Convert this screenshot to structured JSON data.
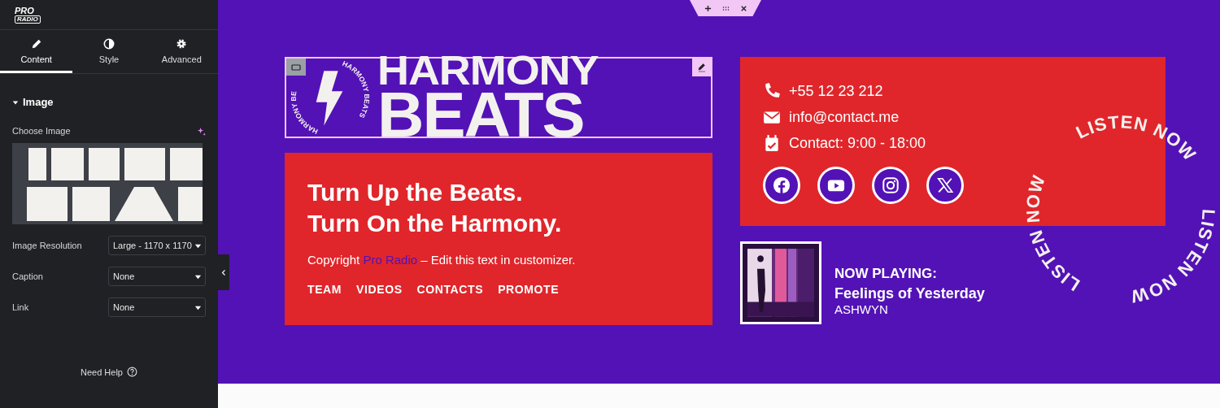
{
  "sidebar": {
    "brand": {
      "line_1": "PRO",
      "line_2": "RADIO"
    },
    "tabs": [
      {
        "label": "Content",
        "selected": true
      },
      {
        "label": "Style",
        "selected": false
      },
      {
        "label": "Advanced",
        "selected": false
      }
    ],
    "section": {
      "title": "Image",
      "expanded": true
    },
    "choose_image": {
      "label": "Choose Image"
    },
    "fields": [
      {
        "label": "Image Resolution",
        "value": "Large - 1170 x 1170"
      },
      {
        "label": "Caption",
        "value": "None"
      },
      {
        "label": "Link",
        "value": "None"
      }
    ],
    "help": "Need Help"
  },
  "logo": {
    "line_1": "HARMONY",
    "line_2": "BEATS",
    "ring_left": "HARMONY BE",
    "ring_right": "HARMONY BEATS"
  },
  "footer_card": {
    "tagline": [
      "Turn Up the Beats.",
      "Turn On the Harmony."
    ],
    "copyright": {
      "before": "Copyright ",
      "link": "Pro Radio",
      "after": " – Edit this text in customizer."
    },
    "menu": [
      "TEAM",
      "VIDEOS",
      "CONTACTS",
      "PROMOTE"
    ]
  },
  "contact_card": {
    "contacts": [
      {
        "kind": "phone",
        "text": "+55 12 23 212"
      },
      {
        "kind": "email",
        "text": "info@contact.me"
      },
      {
        "kind": "calendar",
        "text": "Contact: 9:00 - 18:00"
      }
    ],
    "socials": [
      {
        "kind": "facebook"
      },
      {
        "kind": "youtube"
      },
      {
        "kind": "instagram"
      },
      {
        "kind": "x"
      }
    ]
  },
  "now_playing": {
    "label": "NOW PLAYING:",
    "title": "Feelings of Yesterday",
    "artist": "ASHWYN"
  },
  "listen_now": [
    "LISTEN NOW",
    "LISTEN NOW",
    "LISTEN NOW"
  ]
}
